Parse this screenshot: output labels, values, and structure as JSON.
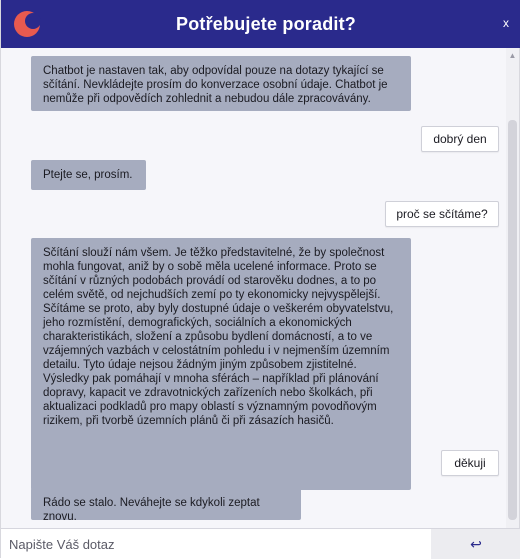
{
  "header": {
    "title": "Potřebujete poradit?",
    "logo_icon": "crescent-logo-icon",
    "close_label": "x",
    "bg_color": "#2a2a8c",
    "logo_color": "#e85a4f"
  },
  "messages": [
    {
      "role": "bot",
      "text": "Chatbot je nastaven tak, aby odpovídal pouze na dotazy tykající se sčítání. Nevkládejte prosím do konverzace osobní údaje. Chatbot je nemůže při odpovědích zohlednit a nebudou dále zpracovávány."
    },
    {
      "role": "user",
      "text": "dobrý den"
    },
    {
      "role": "bot",
      "text": "Ptejte se, prosím."
    },
    {
      "role": "user",
      "text": "proč se sčítáme?"
    },
    {
      "role": "bot",
      "text": "Sčítání slouží nám všem. Je těžko představitelné, že by společnost mohla fungovat, aniž by o sobě měla ucelené informace. Proto se sčítání v různých podobách provádí od starověku dodnes, a to po celém světě, od nejchudších zemí po ty ekonomicky nejvyspělejší. Sčítáme se proto, aby byly dostupné údaje o veškerém obyvatelstvu, jeho rozmístění, demografických, sociálních a ekonomických charakteristikách, složení a způsobu bydlení domácností, a to ve vzájemných vazbách v celostátním pohledu i v nejmenším územním detailu. Tyto údaje nejsou žádným jiným způsobem zjistitelné. Výsledky pak pomáhají v mnoha sférách – například při plánování dopravy, kapacit ve zdravotnických zařízeních nebo školkách, při aktualizaci podkladů pro mapy oblastí s významným povodňovým rizikem, při tvorbě územních plánů či při zásazích hasičů."
    },
    {
      "role": "user",
      "text": "děkuji"
    },
    {
      "role": "bot",
      "text": "Rádo se stalo. Neváhejte se kdykoli zeptat znovu."
    }
  ],
  "composer": {
    "placeholder": "Napište Váš dotaz",
    "value": "",
    "send_icon": "send-arrow-icon",
    "send_glyph": "↩"
  },
  "colors": {
    "bot_bubble": "#a6acbf",
    "user_bubble": "#ffffff",
    "chat_bg": "#f6f6fa"
  }
}
